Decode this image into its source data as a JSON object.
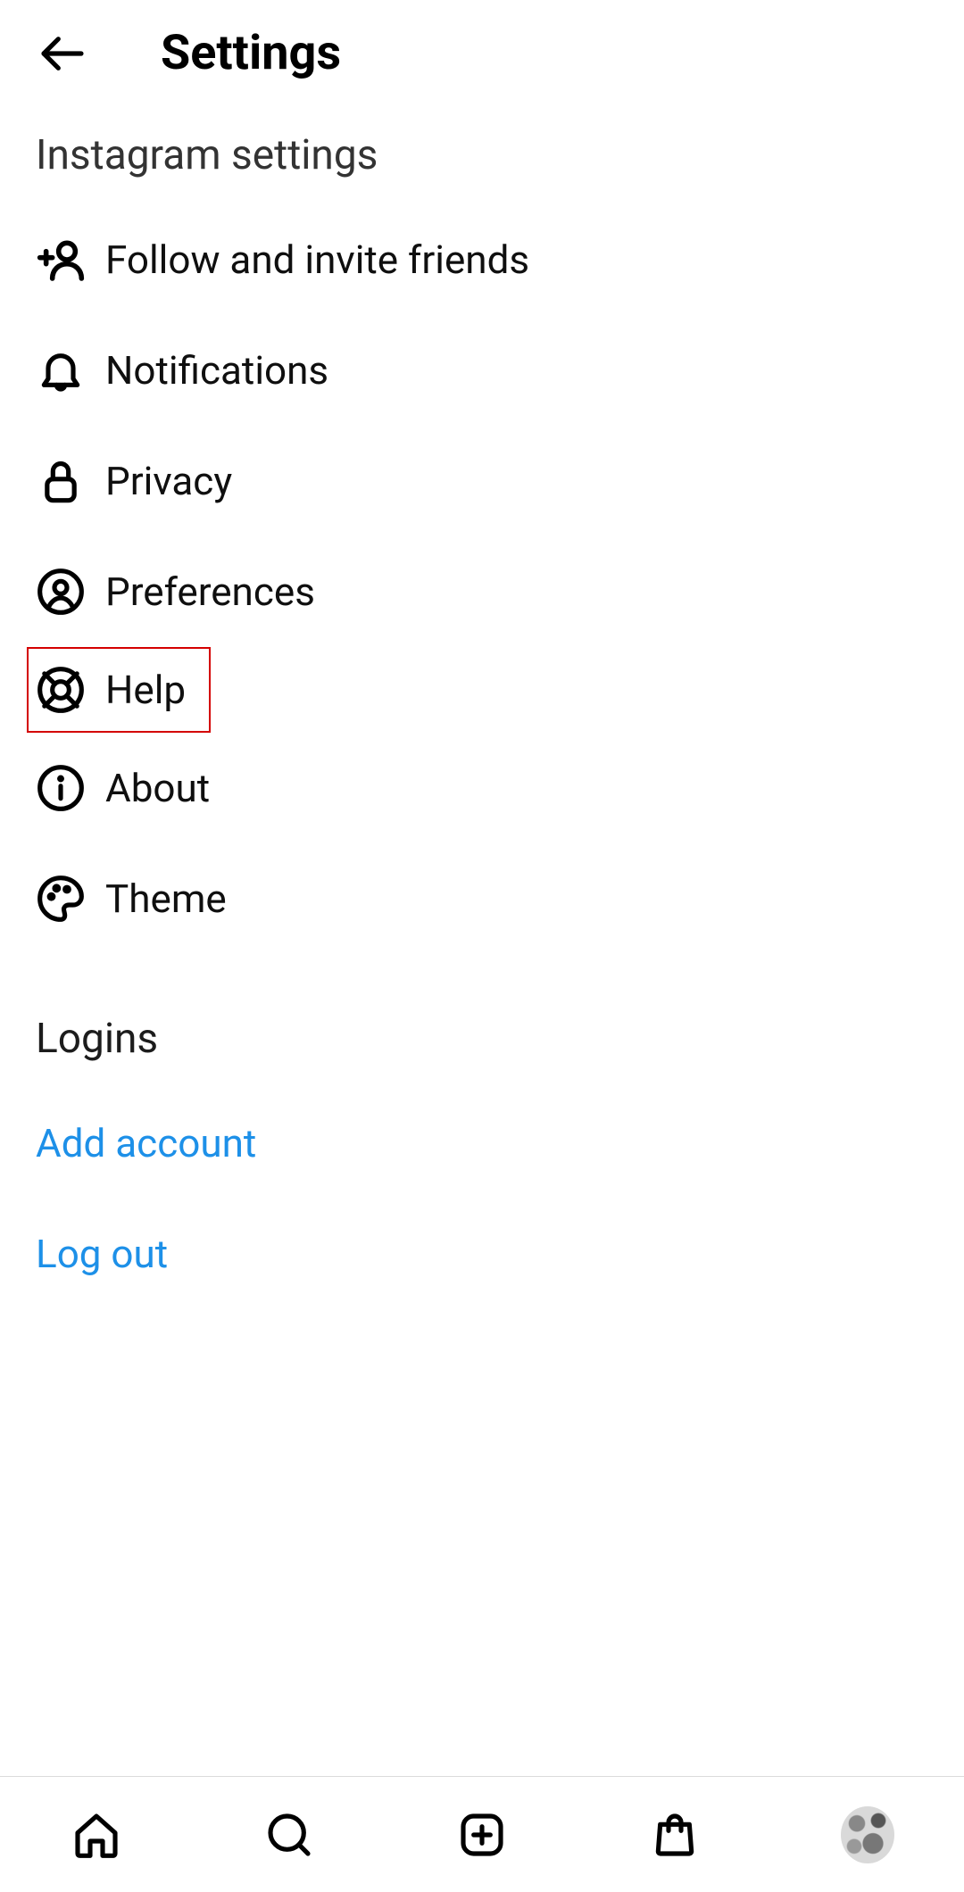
{
  "header": {
    "title": "Settings"
  },
  "sections": {
    "settings_title": "Instagram settings",
    "logins_title": "Logins"
  },
  "menu": {
    "follow_invite": "Follow and invite friends",
    "notifications": "Notifications",
    "privacy": "Privacy",
    "preferences": "Preferences",
    "help": "Help",
    "about": "About",
    "theme": "Theme"
  },
  "links": {
    "add_account": "Add account",
    "log_out": "Log out"
  },
  "colors": {
    "link": "#1d90e8",
    "highlight_border": "#d40000"
  }
}
